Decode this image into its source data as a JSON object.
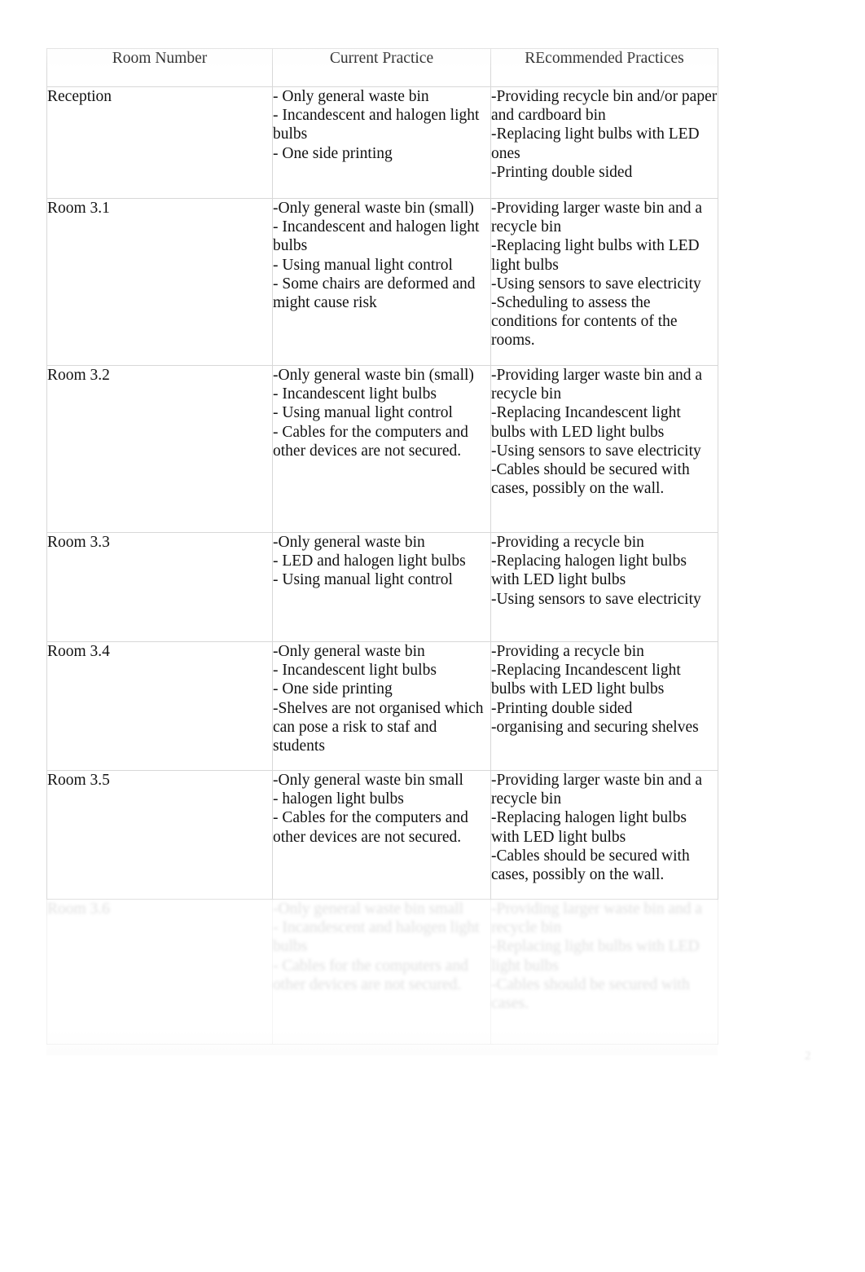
{
  "document": {
    "page_marker": "2"
  },
  "table": {
    "headers": [
      "Room Number",
      "Current Practice",
      "REcommended Practices"
    ],
    "rows": [
      {
        "room": "Reception",
        "current": [
          "- Only general waste bin",
          "- Incandescent and halogen light bulbs",
          "- One side printing"
        ],
        "recommended": [
          "-Providing recycle bin and/or paper and cardboard bin",
          "-Replacing light bulbs with LED ones",
          "-Printing double sided"
        ]
      },
      {
        "room": "Room 3.1",
        "current": [
          "-Only general waste bin (small)",
          "- Incandescent and halogen light bulbs",
          "- Using manual light control",
          "- Some chairs are deformed and might cause risk"
        ],
        "recommended": [
          "-Providing larger waste bin and a recycle bin",
          "-Replacing light bulbs with LED light bulbs",
          "-Using sensors to save electricity",
          "-Scheduling to assess the conditions for contents of the rooms."
        ]
      },
      {
        "room": "Room 3.2",
        "current": [
          "-Only general waste bin (small)",
          "- Incandescent light bulbs",
          "- Using manual light control",
          "- Cables for the computers and other devices are not secured."
        ],
        "recommended": [
          "-Providing larger waste bin and a recycle bin",
          "-Replacing Incandescent  light bulbs with LED light bulbs",
          "-Using sensors to save electricity",
          "-Cables should be secured with cases, possibly on the wall."
        ]
      },
      {
        "room": "Room 3.3",
        "current": [
          "-Only general waste bin",
          "- LED and halogen light bulbs",
          "- Using manual light control"
        ],
        "recommended": [
          "-Providing a recycle bin",
          "-Replacing halogen light bulbs with LED light bulbs",
          "-Using sensors to save electricity"
        ]
      },
      {
        "room": "Room 3.4",
        "current": [
          "-Only general waste bin",
          "- Incandescent light bulbs",
          "- One side printing",
          "-Shelves are not organised which can pose a risk to staf and students"
        ],
        "recommended": [
          "-Providing a recycle bin",
          "-Replacing Incandescent  light bulbs with LED light bulbs",
          "-Printing double sided",
          "-organising and securing shelves"
        ]
      },
      {
        "room": "Room 3.5",
        "current": [
          "-Only general waste bin small",
          "- halogen light bulbs",
          "- Cables for the computers and other devices are not secured."
        ],
        "recommended": [
          "-Providing larger waste bin and a recycle bin",
          "-Replacing halogen light bulbs with LED light bulbs",
          "-Cables should be secured with cases, possibly on the wall."
        ]
      },
      {
        "room": "Room 3.6",
        "current": [
          "-Only general waste bin small",
          "- Incandescent and halogen light bulbs",
          "- Cables for the computers and other devices are not secured."
        ],
        "recommended": [
          "-Providing larger waste bin and a recycle bin",
          "-Replacing light bulbs with LED light bulbs",
          "-Cables should be secured with cases."
        ]
      }
    ]
  }
}
